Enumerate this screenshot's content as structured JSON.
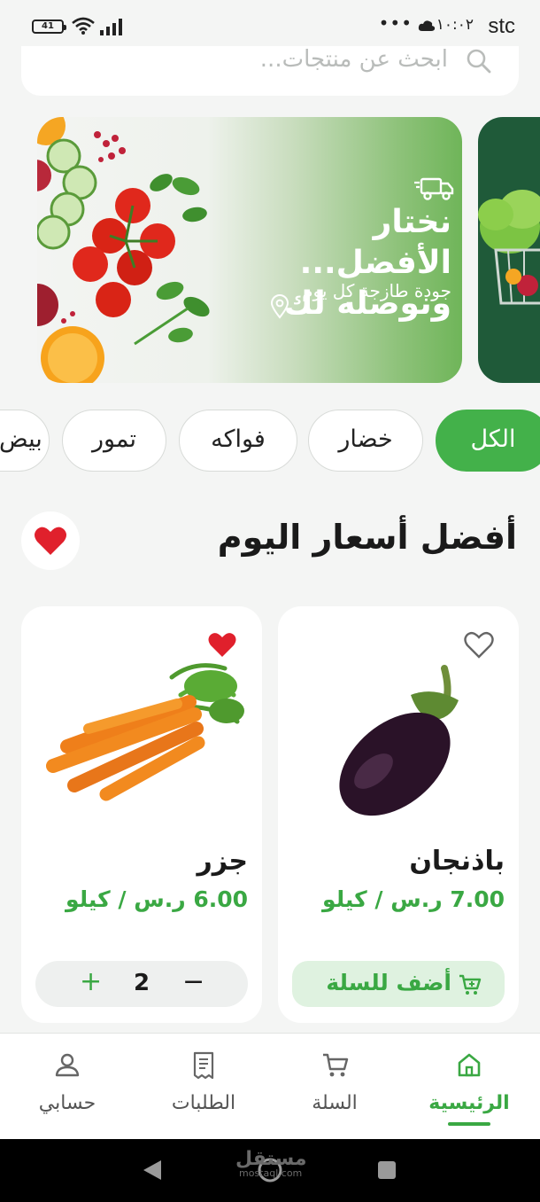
{
  "status_bar": {
    "battery": "41",
    "time": "١٠:٠٢",
    "carrier": "stc",
    "dots": "•••"
  },
  "search": {
    "placeholder": "ابحث عن منتجات..."
  },
  "banner": {
    "title": "نختار الأفضل... ونوصله لك",
    "subtitle": "جودة طازجة كل يوم"
  },
  "categories": [
    {
      "label": "الكل",
      "active": true
    },
    {
      "label": "خضار",
      "active": false
    },
    {
      "label": "فواكه",
      "active": false
    },
    {
      "label": "تمور",
      "active": false
    },
    {
      "label": "بيض",
      "active": false
    }
  ],
  "section": {
    "title": "أفضل أسعار اليوم"
  },
  "products": [
    {
      "name": "باذنجان",
      "price": "7.00 ر.س / كيلو",
      "favorite": false,
      "action": "أضف للسلة"
    },
    {
      "name": "جزر",
      "price": "6.00 ر.س / كيلو",
      "favorite": true,
      "quantity": "2"
    }
  ],
  "bottom_nav": [
    {
      "label": "الرئيسية",
      "icon": "home-icon",
      "active": true
    },
    {
      "label": "السلة",
      "icon": "cart-icon",
      "active": false
    },
    {
      "label": "الطلبات",
      "icon": "orders-icon",
      "active": false
    },
    {
      "label": "حسابي",
      "icon": "profile-icon",
      "active": false
    }
  ],
  "watermark": {
    "text": "مستقل",
    "sub": "mostaql.com"
  },
  "colors": {
    "accent": "#43b14a",
    "price": "#3aa843",
    "heart": "#e0202c"
  }
}
